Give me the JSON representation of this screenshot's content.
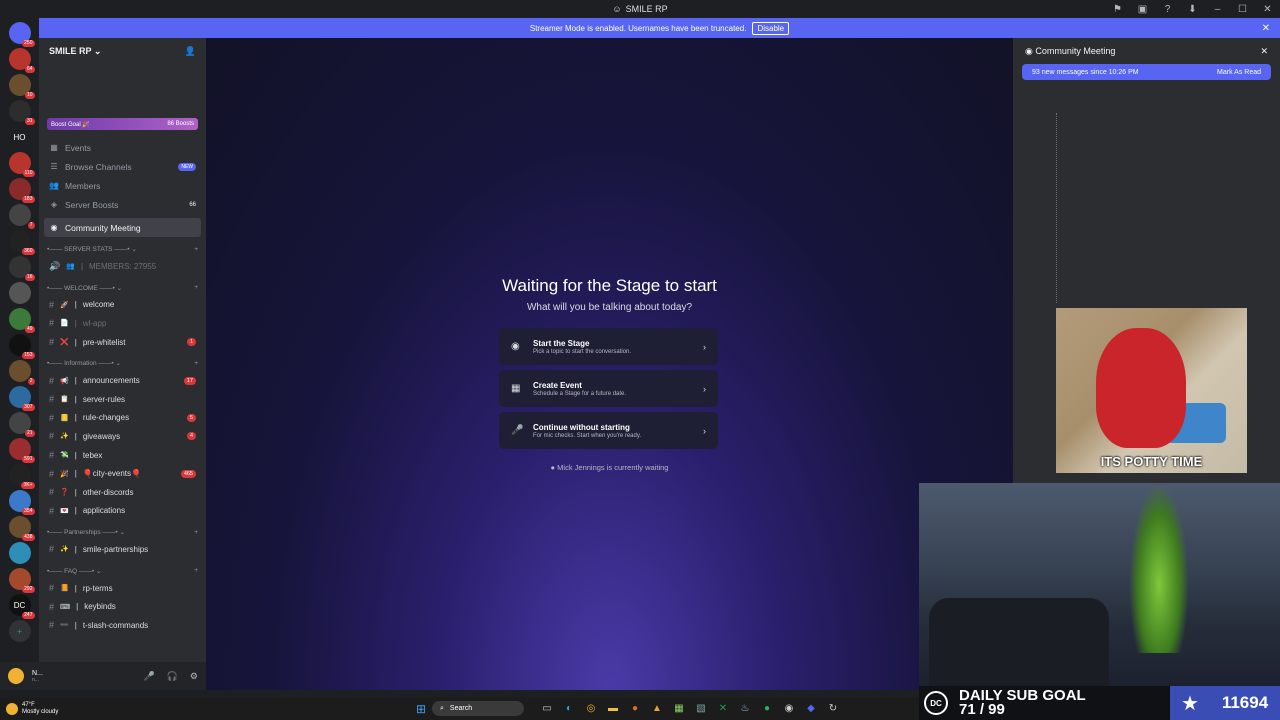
{
  "window": {
    "title": "SMILE RP"
  },
  "banner": {
    "text": "Streamer Mode is enabled. Usernames have been truncated.",
    "button": "Disable"
  },
  "servers": [
    {
      "label": "",
      "badge": "250",
      "color": "#5865f2"
    },
    {
      "label": "",
      "badge": "64",
      "color": "#b8352d"
    },
    {
      "label": "",
      "badge": "10",
      "color": "#6b4e2e"
    },
    {
      "label": "",
      "badge": "31",
      "color": "#2d2d2d"
    },
    {
      "label": "HO",
      "badge": "",
      "color": "#1e1f22"
    },
    {
      "label": "",
      "badge": "110",
      "color": "#b8352d"
    },
    {
      "label": "",
      "badge": "183",
      "color": "#8a2a2a"
    },
    {
      "label": "",
      "badge": "7",
      "color": "#444"
    },
    {
      "label": "",
      "badge": "360",
      "color": "#222"
    },
    {
      "label": "",
      "badge": "16",
      "color": "#333"
    },
    {
      "label": "",
      "badge": "",
      "color": "#555"
    },
    {
      "label": "",
      "badge": "49",
      "color": "#3c7a3a"
    },
    {
      "label": "",
      "badge": "153",
      "color": "#111"
    },
    {
      "label": "",
      "badge": "2",
      "color": "#6b4e2e"
    },
    {
      "label": "",
      "badge": "307",
      "color": "#2d6a9f"
    },
    {
      "label": "",
      "badge": "21",
      "color": "#444"
    },
    {
      "label": "",
      "badge": "591",
      "color": "#9a2d2d"
    },
    {
      "label": "",
      "badge": "3K+",
      "color": "#222"
    },
    {
      "label": "",
      "badge": "354",
      "color": "#3c7ac9"
    },
    {
      "label": "",
      "badge": "438",
      "color": "#6b4e2e"
    },
    {
      "label": "",
      "badge": "",
      "color": "#2d8fb8"
    },
    {
      "label": "",
      "badge": "292",
      "color": "#a34a2d"
    },
    {
      "label": "DC",
      "badge": "247",
      "color": "#111"
    }
  ],
  "sidebar": {
    "server_name": "SMILE RP",
    "boost": {
      "label": "Boost Goal 🎉",
      "count": "86 Boosts"
    },
    "nav": [
      {
        "label": "Events",
        "icon": "calendar-icon",
        "extra": ""
      },
      {
        "label": "Browse Channels",
        "icon": "browse-icon",
        "extra": "NEW"
      },
      {
        "label": "Members",
        "icon": "members-icon",
        "extra": ""
      },
      {
        "label": "Server Boosts",
        "icon": "boost-icon",
        "extra": "66"
      }
    ],
    "active_channel": "Community Meeting",
    "categories": [
      {
        "name": "SERVER STATS",
        "channels": [
          {
            "name": "MEMBERS: 27955",
            "emoji": "👥",
            "muted": true,
            "badge": ""
          }
        ]
      },
      {
        "name": "WELCOME",
        "channels": [
          {
            "name": "welcome",
            "emoji": "🚀",
            "muted": false,
            "badge": ""
          },
          {
            "name": "wl-app",
            "emoji": "📄",
            "muted": true,
            "badge": ""
          },
          {
            "name": "pre-whitelist",
            "emoji": "❌",
            "muted": false,
            "badge": "1"
          }
        ]
      },
      {
        "name": "Information",
        "channels": [
          {
            "name": "announcements",
            "emoji": "📢",
            "muted": false,
            "badge": "17"
          },
          {
            "name": "server-rules",
            "emoji": "📋",
            "muted": false,
            "badge": ""
          },
          {
            "name": "rule-changes",
            "emoji": "📒",
            "muted": false,
            "badge": "5"
          },
          {
            "name": "giveaways",
            "emoji": "✨",
            "muted": false,
            "badge": "4"
          },
          {
            "name": "tebex",
            "emoji": "💸",
            "muted": false,
            "badge": ""
          },
          {
            "name": "🎈city-events🎈",
            "emoji": "🎉",
            "muted": false,
            "badge": "465"
          },
          {
            "name": "other-discords",
            "emoji": "❓",
            "muted": false,
            "badge": ""
          },
          {
            "name": "applications",
            "emoji": "💌",
            "muted": false,
            "badge": ""
          }
        ]
      },
      {
        "name": "Partnerships",
        "channels": [
          {
            "name": "smile-partnerships",
            "emoji": "✨",
            "muted": false,
            "badge": ""
          }
        ]
      },
      {
        "name": "FAQ",
        "channels": [
          {
            "name": "rp-terms",
            "emoji": "📙",
            "muted": false,
            "badge": ""
          },
          {
            "name": "keybinds",
            "emoji": "⌨",
            "muted": false,
            "badge": ""
          },
          {
            "name": "t-slash-commands",
            "emoji": "➖",
            "muted": false,
            "badge": ""
          }
        ]
      }
    ]
  },
  "user_panel": {
    "name": "N...",
    "status": "n..."
  },
  "stage": {
    "title": "Waiting for the Stage to start",
    "subtitle": "What will you be talking about today?",
    "options": [
      {
        "title": "Start the Stage",
        "desc": "Pick a topic to start the conversation.",
        "icon": "stage-icon"
      },
      {
        "title": "Create Event",
        "desc": "Schedule a Stage for a future date.",
        "icon": "calendar-icon"
      },
      {
        "title": "Continue without starting",
        "desc": "For mic checks. Start when you're ready.",
        "icon": "mic-icon"
      }
    ],
    "waiting": "Mick Jennings is currently waiting"
  },
  "chat_panel": {
    "title": "Community Meeting",
    "new_messages": "93 new messages since 10:26 PM",
    "mark_read": "Mark As Read",
    "gif_caption": "ITS POTTY TIME"
  },
  "overlay": {
    "goal_title": "DAILY SUB GOAL",
    "goal_progress": "71 / 99",
    "count": "11694"
  },
  "taskbar": {
    "temp": "47°F",
    "condition": "Mostly cloudy",
    "search": "Search"
  }
}
